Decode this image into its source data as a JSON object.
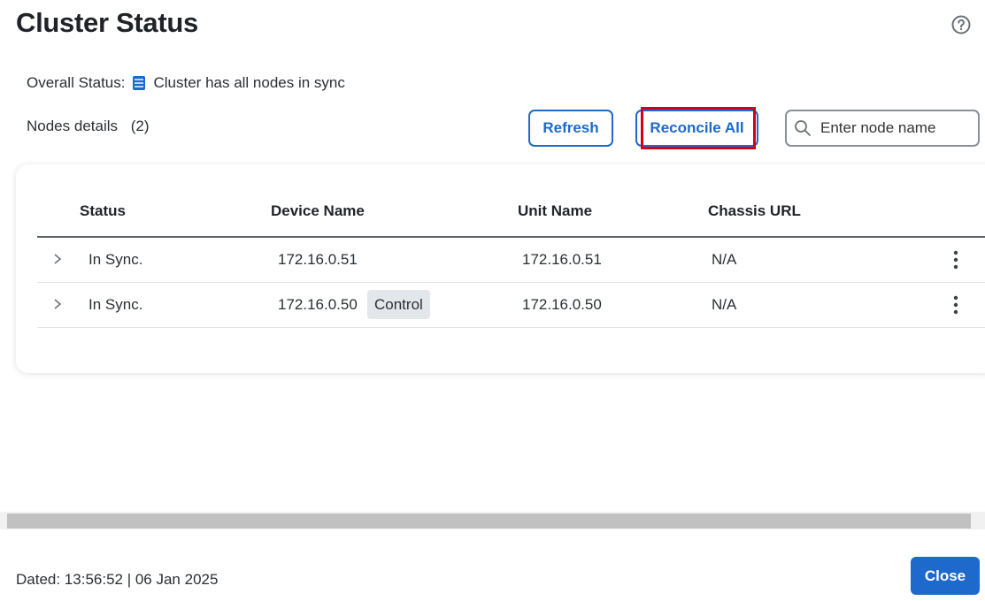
{
  "header": {
    "title": "Cluster Status",
    "help_icon": "question-circle-icon"
  },
  "overall_status": {
    "label": "Overall Status:",
    "icon": "cluster-sync-icon",
    "text": "Cluster has all nodes in sync"
  },
  "nodes": {
    "label": "Nodes details",
    "count": "(2)"
  },
  "toolbar": {
    "refresh_label": "Refresh",
    "reconcile_label": "Reconcile All",
    "search_placeholder": "Enter node name",
    "search_value": ""
  },
  "table": {
    "columns": [
      "Status",
      "Device Name",
      "Unit Name",
      "Chassis URL"
    ],
    "rows": [
      {
        "status": "In Sync.",
        "device": "172.16.0.51",
        "tag": "",
        "unit": "172.16.0.51",
        "chassis": "N/A"
      },
      {
        "status": "In Sync.",
        "device": "172.16.0.50",
        "tag": "Control",
        "unit": "172.16.0.50",
        "chassis": "N/A"
      }
    ]
  },
  "footer": {
    "dated": "Dated: 13:56:52 | 06 Jan 2025",
    "close_label": "Close"
  },
  "colors": {
    "accent": "#1d69cc",
    "highlight": "#d0021b"
  }
}
